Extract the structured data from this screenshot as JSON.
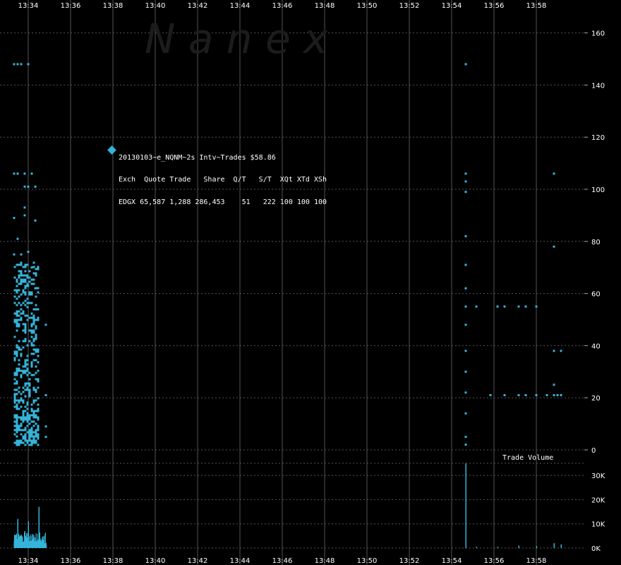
{
  "watermark": "N a n e x",
  "x_ticks": [
    "13:34",
    "13:36",
    "13:38",
    "13:40",
    "13:42",
    "13:44",
    "13:46",
    "13:48",
    "13:50",
    "13:52",
    "13:54",
    "13:56",
    "13:58"
  ],
  "price_ticks": [
    "160",
    "140",
    "120",
    "100",
    "80",
    "60",
    "40",
    "20",
    "0"
  ],
  "volume_ticks": [
    "30K",
    "20K",
    "10K",
    "0K"
  ],
  "info": {
    "title": "20130103~e_NQNM~2s Intv~Trades $58.86",
    "header": "Exch  Quote Trade   Share  Q/T   S/T  XQt XTd XSh",
    "row": "EDGX 65,587 1,288 286,453    51   222 100 100 100"
  },
  "volume_label": "Trade Volume",
  "colors": {
    "background": "#000000",
    "points": "#35b4d9",
    "grid": "#555555"
  },
  "chart_data": {
    "type": "scatter",
    "title": "20130103~e_NQNM~2s Intv~Trades $58.86",
    "x_range": [
      "13:33:20",
      "13:59:50"
    ],
    "x_tick_step_minutes": 2,
    "price_ylim": [
      0,
      165
    ],
    "volume_ylim": [
      0,
      38000
    ],
    "price_series": [
      {
        "t": "13:34:50",
        "y": 48
      },
      {
        "t": "13:34:50",
        "y": 21
      },
      {
        "t": "13:34:50",
        "y": 9
      },
      {
        "t": "13:34:50",
        "y": 5
      },
      {
        "t": "13:33:20",
        "y": 148
      },
      {
        "t": "13:33:30",
        "y": 148
      },
      {
        "t": "13:33:40",
        "y": 148
      },
      {
        "t": "13:34:00",
        "y": 148
      },
      {
        "t": "13:33:20",
        "y": 106
      },
      {
        "t": "13:33:30",
        "y": 106
      },
      {
        "t": "13:33:50",
        "y": 106
      },
      {
        "t": "13:34:10",
        "y": 106
      },
      {
        "t": "13:33:50",
        "y": 101
      },
      {
        "t": "13:34:00",
        "y": 101
      },
      {
        "t": "13:34:20",
        "y": 101
      },
      {
        "t": "13:33:50",
        "y": 93
      },
      {
        "t": "13:33:50",
        "y": 90
      },
      {
        "t": "13:34:20",
        "y": 88
      },
      {
        "t": "13:33:20",
        "y": 89
      },
      {
        "t": "13:33:30",
        "y": 81
      },
      {
        "t": "13:33:20",
        "y": 75
      },
      {
        "t": "13:33:40",
        "y": 75
      },
      {
        "t": "13:34:00",
        "y": 76
      },
      {
        "t": "13:34:10",
        "y": 70
      },
      {
        "t": "13:34:00",
        "y": 63
      },
      {
        "t": "13:34:20",
        "y": 62
      },
      {
        "t": "13:54:40",
        "y": 148
      },
      {
        "t": "13:54:40",
        "y": 106
      },
      {
        "t": "13:54:40",
        "y": 103
      },
      {
        "t": "13:54:40",
        "y": 99
      },
      {
        "t": "13:54:40",
        "y": 82
      },
      {
        "t": "13:54:40",
        "y": 71
      },
      {
        "t": "13:54:40",
        "y": 62
      },
      {
        "t": "13:54:40",
        "y": 55
      },
      {
        "t": "13:54:40",
        "y": 48
      },
      {
        "t": "13:54:40",
        "y": 38
      },
      {
        "t": "13:54:40",
        "y": 30
      },
      {
        "t": "13:54:40",
        "y": 22
      },
      {
        "t": "13:54:40",
        "y": 14
      },
      {
        "t": "13:54:40",
        "y": 5
      },
      {
        "t": "13:54:40",
        "y": 2
      },
      {
        "t": "13:55:10",
        "y": 55
      },
      {
        "t": "13:56:10",
        "y": 55
      },
      {
        "t": "13:56:30",
        "y": 55
      },
      {
        "t": "13:57:10",
        "y": 55
      },
      {
        "t": "13:57:30",
        "y": 55
      },
      {
        "t": "13:58:00",
        "y": 55
      },
      {
        "t": "13:55:50",
        "y": 21
      },
      {
        "t": "13:56:30",
        "y": 21
      },
      {
        "t": "13:57:10",
        "y": 21
      },
      {
        "t": "13:57:30",
        "y": 21
      },
      {
        "t": "13:58:00",
        "y": 21
      },
      {
        "t": "13:58:30",
        "y": 21
      },
      {
        "t": "13:59:00",
        "y": 21
      },
      {
        "t": "13:59:10",
        "y": 21
      },
      {
        "t": "13:58:50",
        "y": 106
      },
      {
        "t": "13:58:50",
        "y": 78
      },
      {
        "t": "13:58:50",
        "y": 38
      },
      {
        "t": "13:59:10",
        "y": 38
      },
      {
        "t": "13:58:50",
        "y": 25
      },
      {
        "t": "13:58:50",
        "y": 21
      }
    ],
    "dense_cluster": {
      "t_range": [
        "13:33:20",
        "13:34:30"
      ],
      "y_range": [
        2,
        72
      ],
      "count": 520
    },
    "volume_series": [
      {
        "t": "13:33:20",
        "v": 3000
      },
      {
        "t": "13:33:30",
        "v": 12000
      },
      {
        "t": "13:33:40",
        "v": 4000
      },
      {
        "t": "13:33:50",
        "v": 7000
      },
      {
        "t": "13:34:00",
        "v": 11000
      },
      {
        "t": "13:34:10",
        "v": 5000
      },
      {
        "t": "13:34:20",
        "v": 4000
      },
      {
        "t": "13:34:30",
        "v": 17000
      },
      {
        "t": "13:34:40",
        "v": 2000
      },
      {
        "t": "13:34:50",
        "v": 2000
      },
      {
        "t": "13:54:40",
        "v": 35000
      },
      {
        "t": "13:55:10",
        "v": 500
      },
      {
        "t": "13:56:10",
        "v": 500
      },
      {
        "t": "13:57:10",
        "v": 1000
      },
      {
        "t": "13:58:00",
        "v": 800
      },
      {
        "t": "13:58:50",
        "v": 2000
      },
      {
        "t": "13:59:10",
        "v": 1500
      }
    ]
  }
}
